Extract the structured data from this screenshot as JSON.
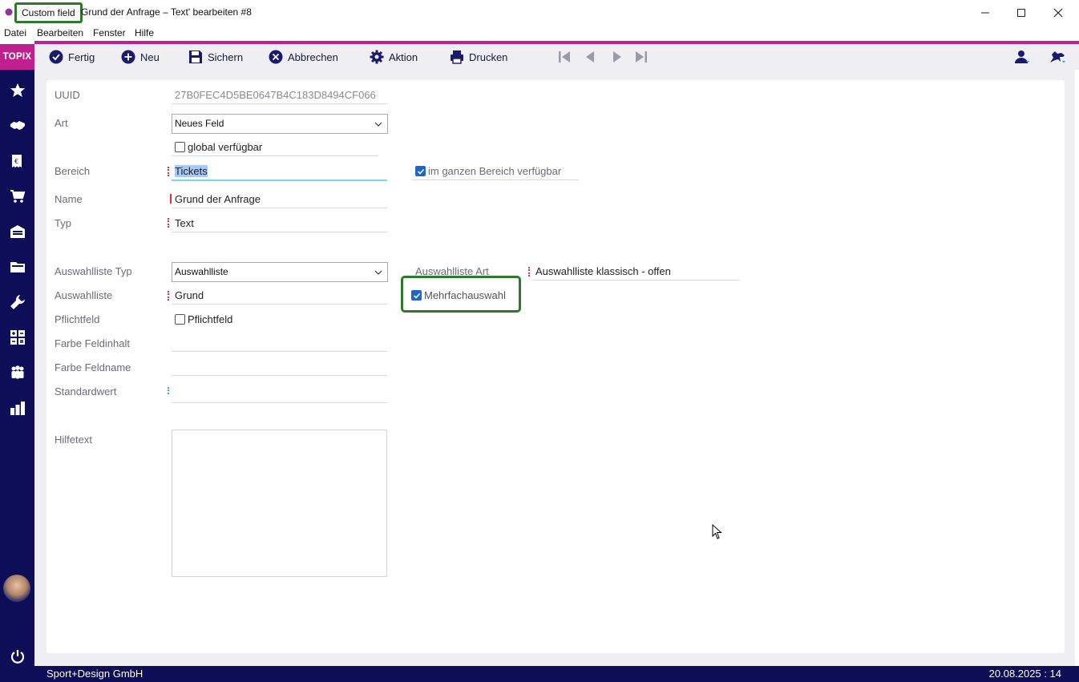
{
  "window": {
    "tag": "Custom field",
    "title": "Grund der Anfrage – Text' bearbeiten #8",
    "controls": [
      "minimize-icon",
      "maximize-icon",
      "close-icon"
    ]
  },
  "menu": {
    "items": [
      "Datei",
      "Bearbeiten",
      "Fenster",
      "Hilfe"
    ]
  },
  "sidebar": {
    "logo": "TOPIX",
    "icons": [
      "star-icon",
      "handshake-icon",
      "invoice-icon",
      "cart-icon",
      "warehouse-icon",
      "folder-icon",
      "wrench-icon",
      "calculator-icon",
      "team-icon",
      "chart-icon",
      "power-icon"
    ]
  },
  "toolbar": {
    "fertig": "Fertig",
    "neu": "Neu",
    "sichern": "Sichern",
    "abbrechen": "Abbrechen",
    "aktion": "Aktion",
    "drucken": "Drucken"
  },
  "form": {
    "uuid_label": "UUID",
    "uuid_value": "27B0FEC4D5BE0647B4C183D8494CF066",
    "art_label": "Art",
    "art_value": "Neues Feld",
    "global_label": "global verfügbar",
    "global_checked": false,
    "bereich_label": "Bereich",
    "bereich_value": "Tickets",
    "ganzer_bereich_label": "im ganzen Bereich verfügbar",
    "ganzer_bereich_checked": true,
    "name_label": "Name",
    "name_value": "Grund der Anfrage",
    "typ_label": "Typ",
    "typ_value": "Text",
    "auswahlliste_typ_label": "Auswahlliste Typ",
    "auswahlliste_typ_value": "Auswahlliste",
    "auswahlliste_art_label": "Auswahlliste Art",
    "auswahlliste_art_value": "Auswahlliste klassisch - offen",
    "auswahlliste_label": "Auswahlliste",
    "auswahlliste_value": "Grund",
    "mehrfach_label": "Mehrfachauswahl",
    "mehrfach_checked": true,
    "pflichtfeld_label": "Pflichtfeld",
    "pflichtfeld_checkbox_label": "Pflichtfeld",
    "pflichtfeld_checked": false,
    "farbe_inhalt_label": "Farbe Feldinhalt",
    "farbe_name_label": "Farbe Feldname",
    "standardwert_label": "Standardwert",
    "hilfetext_label": "Hilfetext"
  },
  "status": {
    "company": "Sport+Design GmbH",
    "date": "20.08.2025 : 14"
  },
  "colors": {
    "sidebar": "#0e0d57",
    "accent": "#c0208f",
    "highlight": "#2b7a28",
    "checkbox": "#1f67c6"
  }
}
